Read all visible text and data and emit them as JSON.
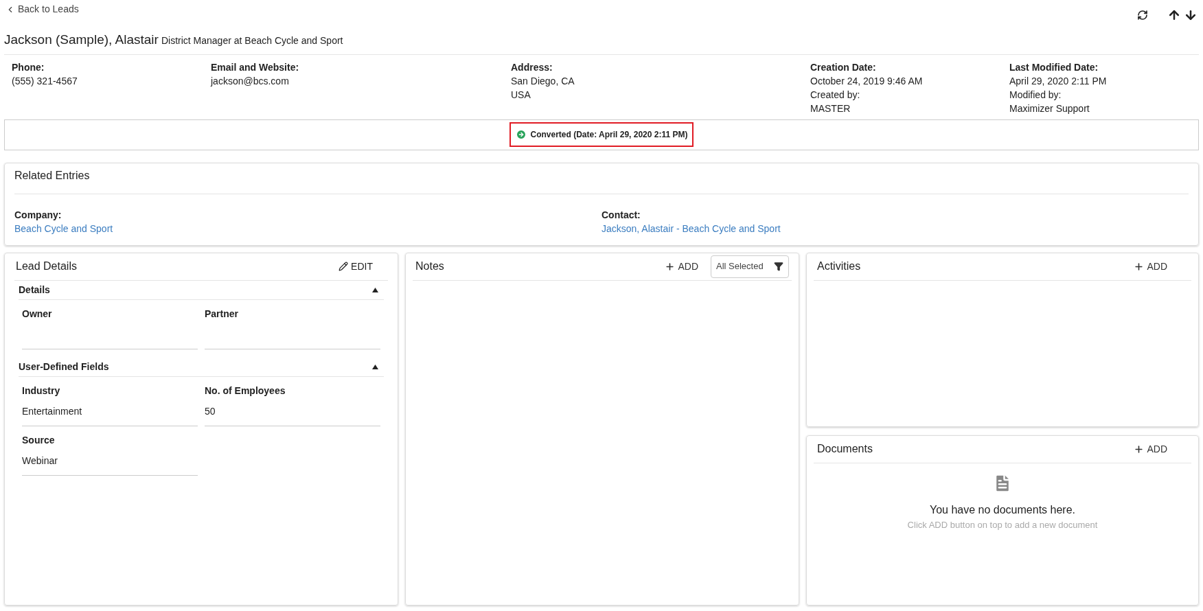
{
  "back_link": "Back to Leads",
  "header": {
    "name": "Jackson (Sample), Alastair",
    "subtitle": "District Manager at Beach Cycle and Sport"
  },
  "info": [
    {
      "label": "Phone:",
      "lines": [
        "(555) 321-4567"
      ]
    },
    {
      "label": "Email and Website:",
      "lines": [
        "jackson@bcs.com"
      ]
    },
    {
      "label": "Address:",
      "lines": [
        "San Diego, CA",
        "USA"
      ]
    },
    {
      "label": "Creation Date:",
      "lines": [
        "October 24, 2019 9:46 AM",
        "Created by:",
        "MASTER"
      ]
    },
    {
      "label": "Last Modified Date:",
      "lines": [
        "April 29, 2020 2:11 PM",
        "Modified by:",
        "Maximizer Support"
      ]
    }
  ],
  "status": {
    "text": "Converted (Date: April 29, 2020 2:11 PM)",
    "highlighted": true
  },
  "related": {
    "title": "Related Entries",
    "items": [
      {
        "label": "Company:",
        "link": "Beach Cycle and Sport"
      },
      {
        "label": "Contact:",
        "link": "Jackson, Alastair - Beach Cycle and Sport"
      }
    ]
  },
  "lead_details": {
    "title": "Lead Details",
    "edit": "EDIT",
    "sections": [
      {
        "title": "Details",
        "expanded": true,
        "fields": [
          {
            "label": "Owner"
          },
          {
            "label": "Partner"
          }
        ]
      },
      {
        "title": "User-Defined Fields",
        "expanded": true,
        "fields": [
          {
            "label": "Industry",
            "value": "Entertainment"
          },
          {
            "label": "No. of Employees",
            "value": "50"
          },
          {
            "label": "Source",
            "value": "Webinar"
          }
        ]
      }
    ]
  },
  "notes": {
    "title": "Notes",
    "add": "ADD",
    "filter": "All Selected"
  },
  "activities": {
    "title": "Activities",
    "add": "ADD"
  },
  "documents": {
    "title": "Documents",
    "add": "ADD",
    "empty_title": "You have no documents here.",
    "empty_hint": "Click ADD button on top to add a new document"
  }
}
